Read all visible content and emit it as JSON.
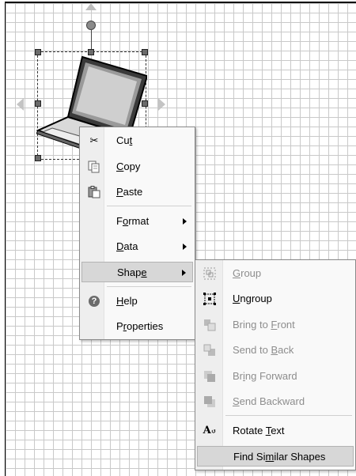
{
  "context_menu": {
    "items": [
      {
        "label_pre": "Cu",
        "label_u": "t",
        "label_post": "",
        "icon": "scissors-icon",
        "highlighted": false,
        "has_submenu": false
      },
      {
        "label_pre": "",
        "label_u": "C",
        "label_post": "opy",
        "icon": "copy-icon",
        "highlighted": false,
        "has_submenu": false
      },
      {
        "label_pre": "",
        "label_u": "P",
        "label_post": "aste",
        "icon": "paste-icon",
        "highlighted": false,
        "has_submenu": false
      },
      {
        "label_pre": "F",
        "label_u": "o",
        "label_post": "rmat",
        "icon": "",
        "highlighted": false,
        "has_submenu": true
      },
      {
        "label_pre": "",
        "label_u": "D",
        "label_post": "ata",
        "icon": "",
        "highlighted": false,
        "has_submenu": true
      },
      {
        "label_pre": "Shap",
        "label_u": "e",
        "label_post": "",
        "icon": "",
        "highlighted": true,
        "has_submenu": true
      },
      {
        "label_pre": "",
        "label_u": "H",
        "label_post": "elp",
        "icon": "help-icon",
        "highlighted": false,
        "has_submenu": false
      },
      {
        "label_pre": "P",
        "label_u": "r",
        "label_post": "operties",
        "icon": "",
        "highlighted": false,
        "has_submenu": false
      }
    ]
  },
  "shape_submenu": {
    "items": [
      {
        "label_pre": "",
        "label_u": "G",
        "label_post": "roup",
        "icon": "group-icon",
        "disabled": true,
        "highlighted": false
      },
      {
        "label_pre": "",
        "label_u": "U",
        "label_post": "ngroup",
        "icon": "ungroup-icon",
        "disabled": false,
        "highlighted": false
      },
      {
        "label_pre": "Bring to ",
        "label_u": "F",
        "label_post": "ront",
        "icon": "bring-to-front-icon",
        "disabled": true,
        "highlighted": false
      },
      {
        "label_pre": "Send to ",
        "label_u": "B",
        "label_post": "ack",
        "icon": "send-to-back-icon",
        "disabled": true,
        "highlighted": false
      },
      {
        "label_pre": "Br",
        "label_u": "i",
        "label_post": "ng Forward",
        "icon": "bring-forward-icon",
        "disabled": true,
        "highlighted": false
      },
      {
        "label_pre": "",
        "label_u": "S",
        "label_post": "end Backward",
        "icon": "send-backward-icon",
        "disabled": true,
        "highlighted": false
      },
      {
        "label_pre": "Rotate ",
        "label_u": "T",
        "label_post": "ext",
        "icon": "rotate-text-icon",
        "disabled": false,
        "highlighted": false
      },
      {
        "label_pre": "Find Si",
        "label_u": "m",
        "label_post": "ilar Shapes",
        "icon": "",
        "disabled": false,
        "highlighted": true
      }
    ]
  },
  "colors": {
    "menu_bg": "#f9f9f9",
    "highlight": "#d7d7d7",
    "disabled_text": "#8d8d8d"
  }
}
